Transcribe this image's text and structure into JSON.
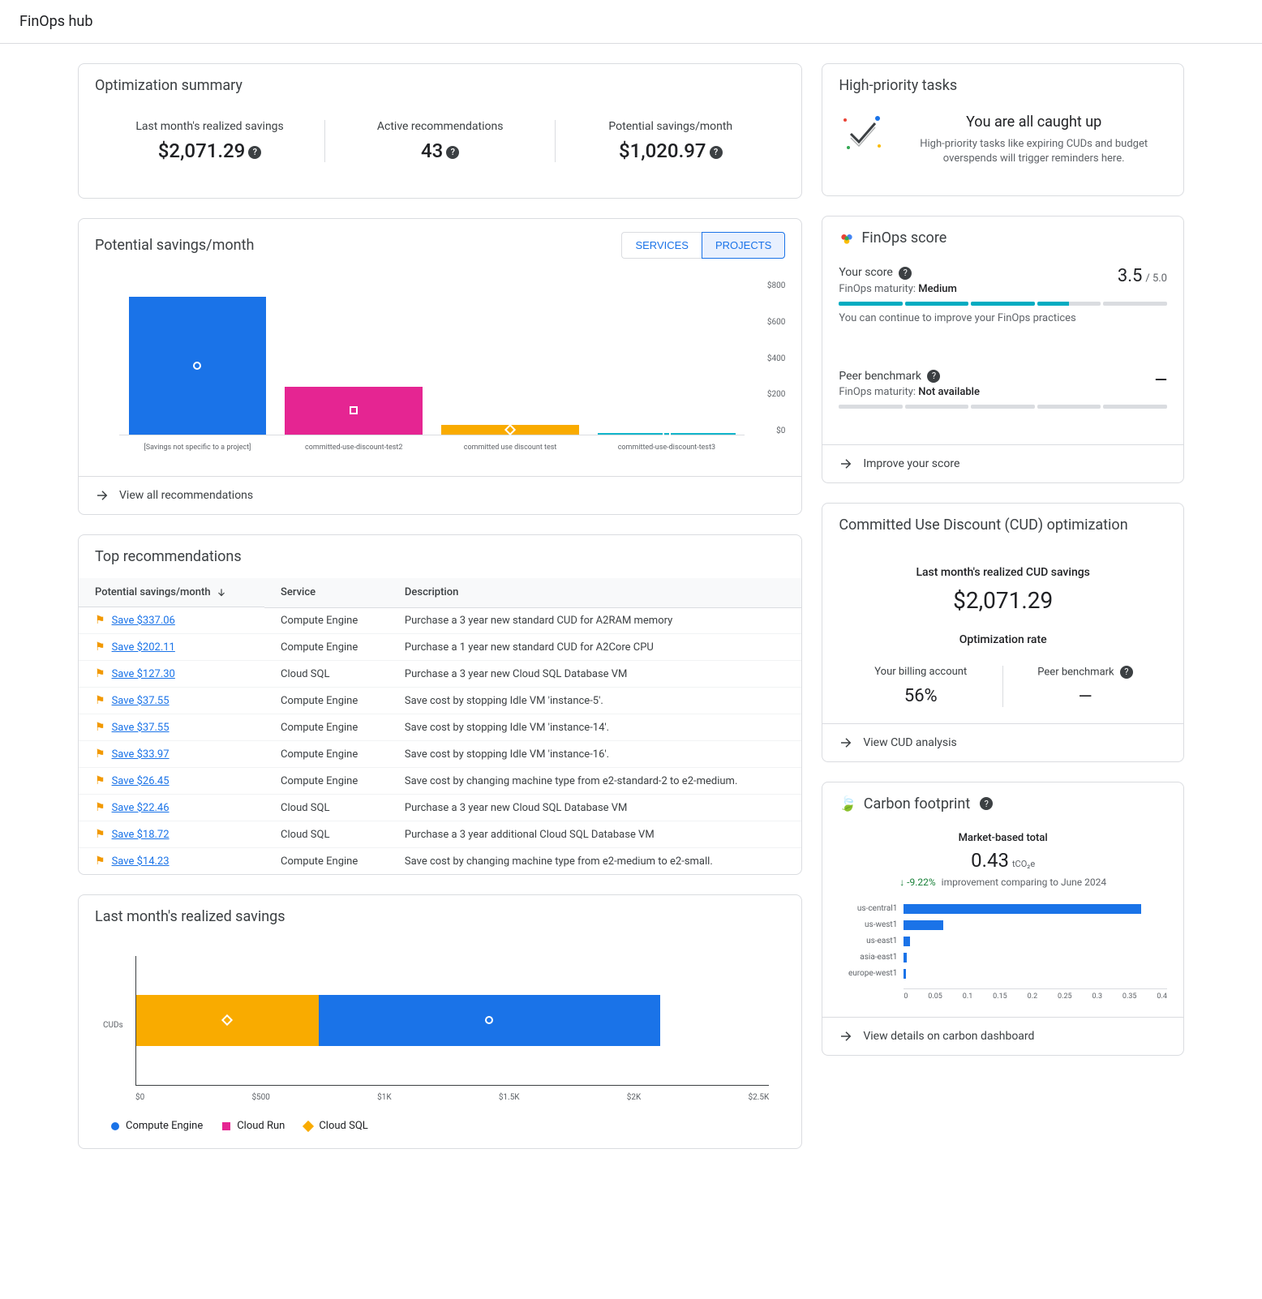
{
  "page_title": "FinOps hub",
  "summary": {
    "title": "Optimization summary",
    "items": [
      {
        "label": "Last month's realized savings",
        "value": "$2,071.29"
      },
      {
        "label": "Active recommendations",
        "value": "43"
      },
      {
        "label": "Potential savings/month",
        "value": "$1,020.97"
      }
    ]
  },
  "high_priority": {
    "title": "High-priority tasks",
    "headline": "You are all caught up",
    "desc": "High-priority tasks like expiring CUDs and budget overspends will trigger reminders here."
  },
  "potential_savings": {
    "title": "Potential savings/month",
    "toggle_services": "SERVICES",
    "toggle_projects": "PROJECTS",
    "view_all": "View all recommendations"
  },
  "finops_score": {
    "title": "FinOps score",
    "your_score_label": "Your score",
    "maturity_label": "FinOps maturity:",
    "maturity_value": "Medium",
    "score": "3.5",
    "max": "/ 5.0",
    "note": "You can continue to improve your FinOps practices",
    "peer_label": "Peer benchmark",
    "peer_maturity": "Not available",
    "improve": "Improve your score"
  },
  "top_recs": {
    "title": "Top recommendations",
    "col_savings": "Potential savings/month",
    "col_service": "Service",
    "col_desc": "Description",
    "rows": [
      {
        "savings": "Save $337.06",
        "service": "Compute Engine",
        "desc": "Purchase a 3 year new standard CUD for A2RAM memory"
      },
      {
        "savings": "Save $202.11",
        "service": "Compute Engine",
        "desc": "Purchase a 1 year new standard CUD for A2Core CPU"
      },
      {
        "savings": "Save $127.30",
        "service": "Cloud SQL",
        "desc": "Purchase a 3 year new Cloud SQL Database VM"
      },
      {
        "savings": "Save $37.55",
        "service": "Compute Engine",
        "desc": "Save cost by stopping Idle VM 'instance-5'."
      },
      {
        "savings": "Save $37.55",
        "service": "Compute Engine",
        "desc": "Save cost by stopping Idle VM 'instance-14'."
      },
      {
        "savings": "Save $33.97",
        "service": "Compute Engine",
        "desc": "Save cost by stopping Idle VM 'instance-16'."
      },
      {
        "savings": "Save $26.45",
        "service": "Compute Engine",
        "desc": "Save cost by changing machine type from e2-standard-2 to e2-medium."
      },
      {
        "savings": "Save $22.46",
        "service": "Cloud SQL",
        "desc": "Purchase a 3 year new Cloud SQL Database VM"
      },
      {
        "savings": "Save $18.72",
        "service": "Cloud SQL",
        "desc": "Purchase a 3 year additional Cloud SQL Database VM"
      },
      {
        "savings": "Save $14.23",
        "service": "Compute Engine",
        "desc": "Save cost by changing machine type from e2-medium to e2-small."
      }
    ]
  },
  "cud": {
    "title": "Committed Use Discount (CUD) optimization",
    "realized_label": "Last month's realized CUD savings",
    "realized_value": "$2,071.29",
    "opt_rate_label": "Optimization rate",
    "billing_label": "Your billing account",
    "billing_value": "56%",
    "peer_label": "Peer benchmark",
    "peer_value": "—",
    "view": "View CUD analysis"
  },
  "realized": {
    "title": "Last month's realized savings",
    "legend": [
      "Compute Engine",
      "Cloud Run",
      "Cloud SQL"
    ]
  },
  "carbon": {
    "title": "Carbon footprint",
    "metric_label": "Market-based total",
    "value": "0.43",
    "unit": "tCO₂e",
    "pct": "-9.22%",
    "note": "improvement comparing to June 2024",
    "view": "View details on carbon dashboard"
  },
  "chart_data": {
    "potential_savings_bar": {
      "type": "bar",
      "title": "Potential savings/month",
      "ylabel": "$",
      "ylim": [
        0,
        800
      ],
      "yticks": [
        "$800",
        "$600",
        "$400",
        "$200",
        "$0"
      ],
      "categories": [
        "[Savings not specific to a project]",
        "committed-use-discount-test2",
        "committed use discount test",
        "committed-use-discount-test3"
      ],
      "values": [
        720,
        250,
        50,
        10
      ],
      "colors": [
        "#1a73e8",
        "#e52592",
        "#f9ab00",
        "#12b5cb"
      ]
    },
    "realized_savings_stacked": {
      "type": "bar",
      "orientation": "horizontal",
      "stacked": true,
      "title": "Last month's realized savings",
      "categories": [
        "CUDs"
      ],
      "series": [
        {
          "name": "Compute Engine",
          "values": [
            1350
          ],
          "color": "#1a73e8",
          "marker": "circle"
        },
        {
          "name": "Cloud Run",
          "values": [
            0
          ],
          "color": "#e52592",
          "marker": "square"
        },
        {
          "name": "Cloud SQL",
          "values": [
            720
          ],
          "color": "#f9ab00",
          "marker": "diamond"
        }
      ],
      "xlim": [
        0,
        2500
      ],
      "xticks": [
        "$0",
        "$500",
        "$1K",
        "$1.5K",
        "$2K",
        "$2.5K"
      ]
    },
    "carbon_bar": {
      "type": "bar",
      "orientation": "horizontal",
      "title": "Carbon footprint by region",
      "xlim": [
        0,
        0.4
      ],
      "xticks": [
        "0",
        "0.05",
        "0.1",
        "0.15",
        "0.2",
        "0.25",
        "0.3",
        "0.35",
        "0.4"
      ],
      "categories": [
        "us-central1",
        "us-west1",
        "us-east1",
        "asia-east1",
        "europe-west1"
      ],
      "values": [
        0.36,
        0.06,
        0.01,
        0.005,
        0.003
      ]
    }
  }
}
